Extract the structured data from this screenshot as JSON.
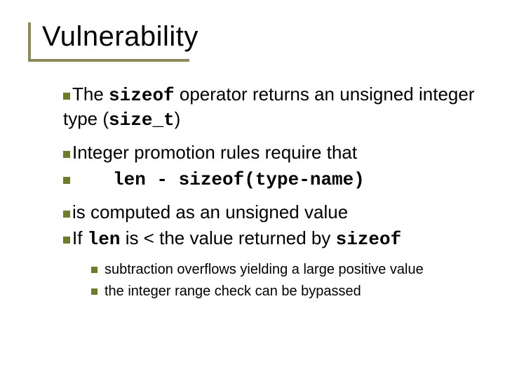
{
  "title": "Vulnerability",
  "p1": {
    "pre": "The ",
    "c1": "sizeof",
    "mid": " operator returns an unsigned integer type (",
    "c2": "size_t",
    "post": ")"
  },
  "p2": "Integer promotion rules require that",
  "p2code": "len - sizeof(type-name)",
  "p3": "is computed as an unsigned value",
  "p4": {
    "pre": "If ",
    "c1": "len",
    "mid": " is < the value returned by ",
    "c2": "sizeof"
  },
  "s1": "subtraction overflows yielding a large positive value",
  "s2": "the integer range check can be bypassed"
}
